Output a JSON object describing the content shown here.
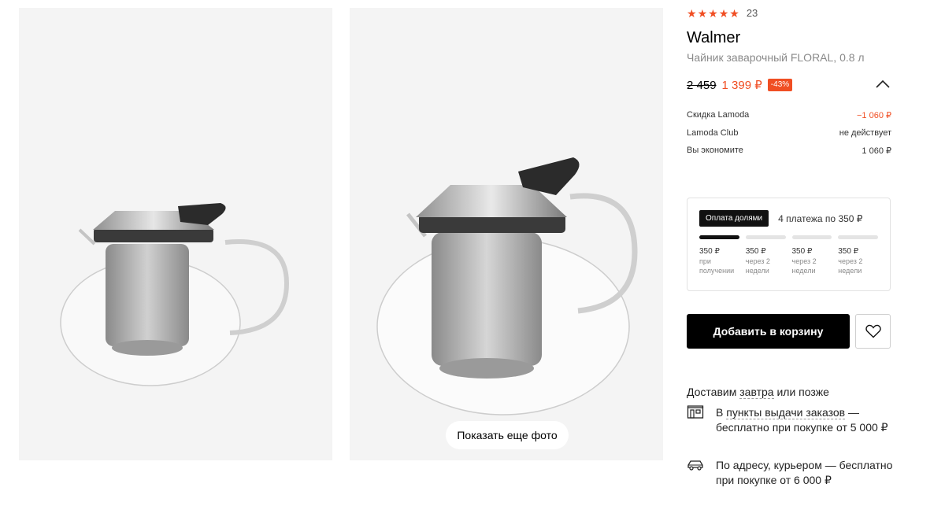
{
  "gallery": {
    "more_photos_label": "Показать еще фото"
  },
  "product": {
    "rating_count": "23",
    "stars_icon": "star-icon",
    "brand": "Walmer",
    "name": "Чайник заварочный FLORAL, 0.8 л",
    "old_price": "2 459",
    "new_price": "1 399 ₽",
    "discount": "-43%",
    "accent_color": "#f04e23"
  },
  "breakdown": [
    {
      "label": "Скидка Lamoda",
      "value": "−1 060 ₽",
      "highlight": true
    },
    {
      "label": "Lamoda Club",
      "value": "не действует",
      "highlight": false
    },
    {
      "label": "Вы экономите",
      "value": "1 060 ₽",
      "highlight": false
    }
  ],
  "installments": {
    "badge": "Оплата долями",
    "summary": "4 платежа по 350 ₽",
    "payments": [
      {
        "amount": "350 ₽",
        "when": "при получении"
      },
      {
        "amount": "350 ₽",
        "when": "через 2 недели"
      },
      {
        "amount": "350 ₽",
        "when": "через 2 недели"
      },
      {
        "amount": "350 ₽",
        "when": "через 2 недели"
      }
    ]
  },
  "actions": {
    "add_to_cart": "Добавить в корзину",
    "wishlist_icon": "heart-icon"
  },
  "delivery": {
    "title_prefix": "Доставим ",
    "title_link": "завтра",
    "title_suffix": " или позже",
    "pickup": {
      "prefix": "В ",
      "link": "пункты выдачи заказов",
      "rest": " — бесплатно при покупке от 5 000 ₽"
    },
    "courier": {
      "text": "По адресу, курьером — бесплатно при покупке от 6 000 ₽"
    }
  }
}
